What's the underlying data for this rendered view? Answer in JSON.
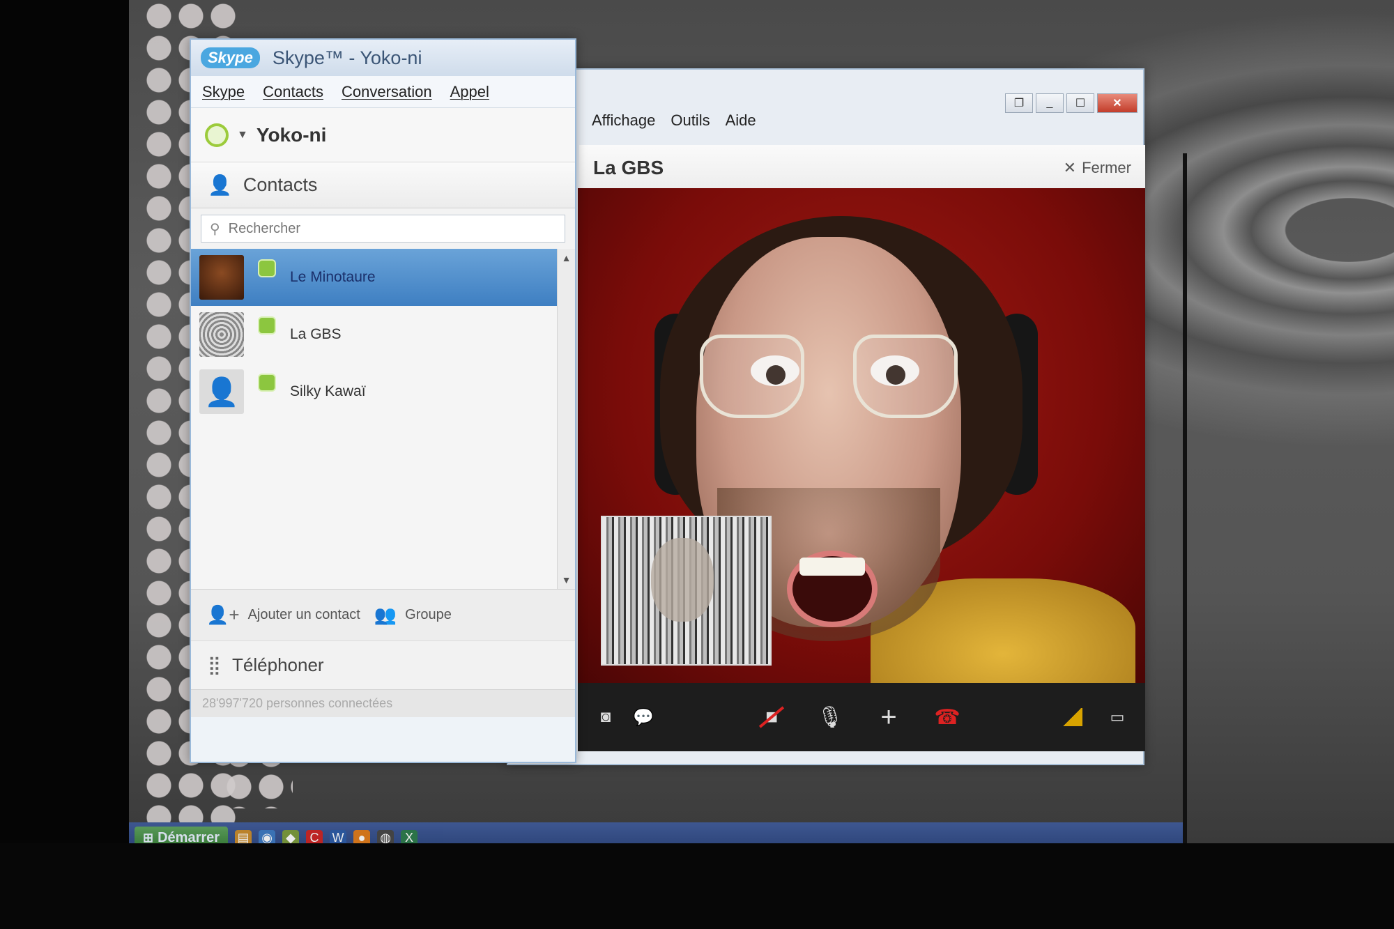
{
  "skype_window": {
    "logo": "Skype",
    "title": "Skype™ - Yoko-ni",
    "menu": [
      "Skype",
      "Contacts",
      "Conversation",
      "Appel"
    ],
    "user_name": "Yoko-ni",
    "contacts_tab": "Contacts",
    "search_placeholder": "Rechercher",
    "contacts": [
      {
        "name": "Le Minotaure",
        "status": "online",
        "selected": true
      },
      {
        "name": "La GBS",
        "status": "online",
        "selected": false
      },
      {
        "name": "Silky Kawaï",
        "status": "online",
        "selected": false
      }
    ],
    "add_contact": "Ajouter un contact",
    "group": "Groupe",
    "phone": "Téléphoner",
    "online_count": "28'997'720 personnes connectées"
  },
  "main_window": {
    "menu": [
      "Affichage",
      "Outils",
      "Aide"
    ],
    "conversation_title": "La GBS",
    "close_label": "Fermer",
    "window_controls": [
      "restore",
      "minimize",
      "maximize",
      "close"
    ],
    "call_controls_left": [
      "screenshot-icon",
      "chat-icon"
    ],
    "call_controls_center": [
      "video-off-icon",
      "microphone-icon",
      "add-icon",
      "hang-up-icon"
    ],
    "call_controls_right": [
      "signal-icon",
      "fullscreen-icon"
    ]
  },
  "taskbar": {
    "start_label": "Démarrer"
  },
  "colors": {
    "selected_contact": "#3e7fc2",
    "status_online": "#8cc63f",
    "hang_up": "#dd2222",
    "video_background": "#7b0f0c"
  }
}
